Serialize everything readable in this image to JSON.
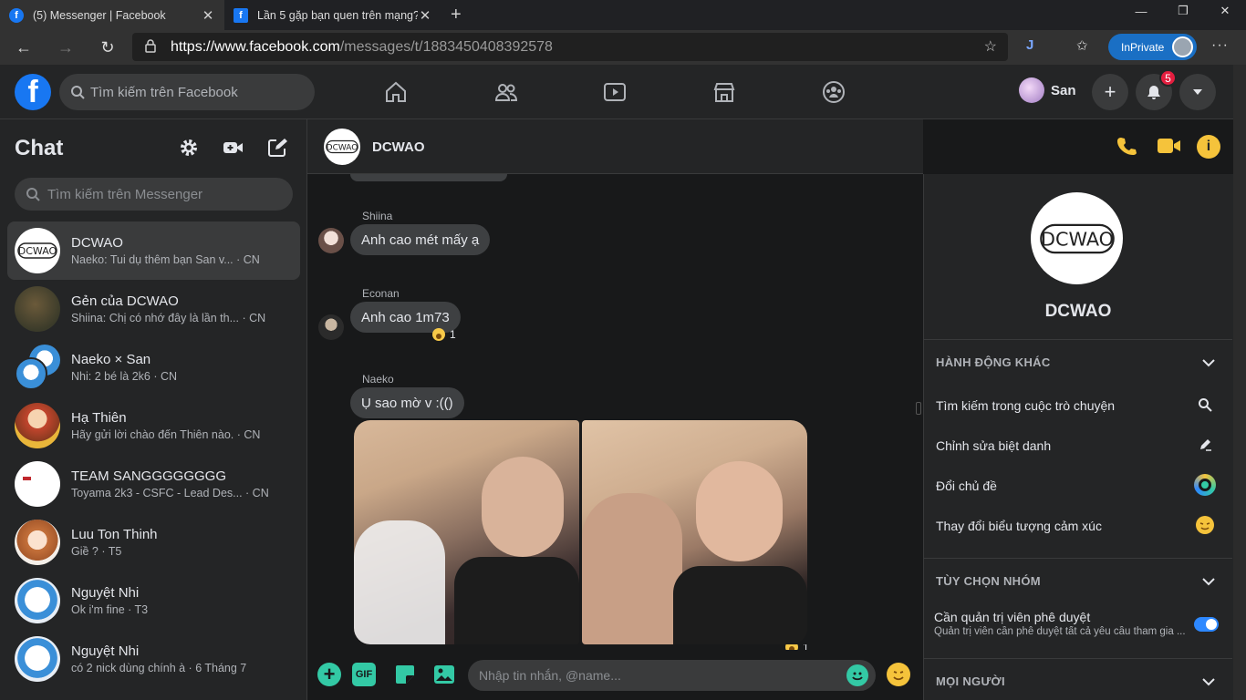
{
  "browser": {
    "tabs": [
      {
        "title": "(5) Messenger | Facebook",
        "favicon": "facebook-icon"
      },
      {
        "title": "Lần 5 gặp bạn quen trên mạng?",
        "favicon": "facebook-icon"
      }
    ],
    "url_host": "https://www.facebook.com",
    "url_path": "/messages/t/1883450408392578",
    "inprivate_label": "InPrivate"
  },
  "fb": {
    "search_placeholder": "Tìm kiếm trên Facebook",
    "user_name": "San",
    "notification_count": "5",
    "accent": "#1877f2"
  },
  "chat_list": {
    "title": "Chat",
    "search_placeholder": "Tìm kiếm trên Messenger",
    "conversations": [
      {
        "name": "DCWAO",
        "preview": "Naeko: Tui dụ thêm bạn San v... · CN",
        "avatar": "dcwao-logo"
      },
      {
        "name": "Gẻn của DCWAO",
        "preview": "Shiina: Chị có nhớ đây là lần th... · CN",
        "avatar": "photo"
      },
      {
        "name": "Naeko × San",
        "preview": "Nhi: 2 bé là 2k6 · CN",
        "avatar": "doraemon"
      },
      {
        "name": "Hạ Thiên",
        "preview": "Hãy gửi lời chào đến Thiên nào. · CN",
        "avatar": "anime"
      },
      {
        "name": "TEAM SANGGGGGGGG",
        "preview": "Toyama 2k3 - CSFC - Lead Des... · CN",
        "avatar": "white"
      },
      {
        "name": "Luu Ton Thinh",
        "preview": "Giề ? · T5",
        "avatar": "anime"
      },
      {
        "name": "Nguyệt Nhi",
        "preview": "Ok i'm fine · T3",
        "avatar": "doraemon"
      },
      {
        "name": "Nguyệt Nhi",
        "preview": "có 2 nick dùng chính à · 6 Tháng 7",
        "avatar": "doraemon"
      }
    ]
  },
  "conversation": {
    "name": "DCWAO",
    "messages": [
      {
        "sender": "Shiina",
        "text": "Anh cao mét mấy ạ"
      },
      {
        "sender": "Econan",
        "text": "Anh cao 1m73",
        "reaction_count": "1"
      },
      {
        "sender": "Naeko",
        "text": "Ụ sao mờ v :(()",
        "photo_reaction_count": "1"
      }
    ],
    "input_placeholder": "Nhập tin nhắn, @name..."
  },
  "info_panel": {
    "name": "DCWAO",
    "more_actions_header": "HÀNH ĐỘNG KHÁC",
    "actions": [
      {
        "label": "Tìm kiếm trong cuộc trò chuyện",
        "icon": "search-icon"
      },
      {
        "label": "Chỉnh sửa biệt danh",
        "icon": "pencil-icon"
      },
      {
        "label": "Đổi chủ đề",
        "icon": "theme-icon"
      },
      {
        "label": "Thay đổi biểu tượng cảm xúc",
        "icon": "emoji-icon"
      }
    ],
    "group_options_header": "TÙY CHỌN NHÓM",
    "approval_title": "Cần quản trị viên phê duyệt",
    "approval_desc": "Quản trị viên cần phê duyệt tất cả yêu cầu tham gia ...",
    "approval_enabled": true,
    "people_header": "MỌI NGƯỜI"
  },
  "colors": {
    "messenger_accent": "#f5c33b",
    "toggle_on": "#2d88ff"
  }
}
